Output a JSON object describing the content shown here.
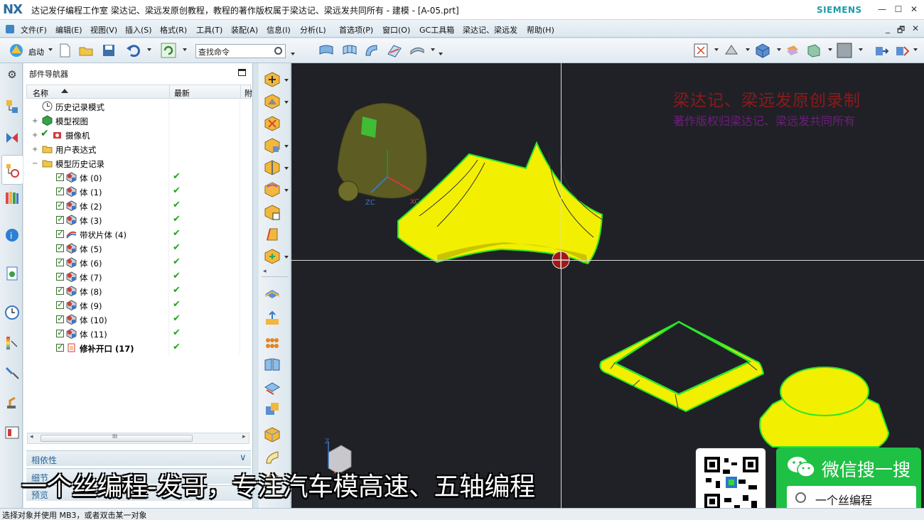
{
  "titlebar": {
    "logo": "NX",
    "title": "达记发仔编程工作室  梁达记、梁远发原创教程，教程的著作版权属于梁达记、梁远发共同所有 - 建模 - [A-05.prt]",
    "brand": "SIEMENS",
    "minimize": "—",
    "maximize": "☐",
    "close": "✕"
  },
  "menubar": {
    "items": [
      "文件(F)",
      "编辑(E)",
      "视图(V)",
      "插入(S)",
      "格式(R)",
      "工具(T)",
      "装配(A)",
      "信息(I)",
      "分析(L)",
      "首选项(P)",
      "窗口(O)",
      "GC工具箱",
      "梁达记、梁远发",
      "帮助(H)"
    ],
    "right": [
      "_",
      "🗗",
      "✕"
    ]
  },
  "toolbar": {
    "start_label": "启动",
    "search_placeholder": "查找命令"
  },
  "navigator": {
    "title": "部件导航器",
    "columns": [
      "名称",
      "最新",
      "附"
    ],
    "rows": [
      {
        "label": "历史记录模式",
        "level": 0,
        "icon": "clock-icon",
        "latest": false,
        "expand": ""
      },
      {
        "label": "模型视图",
        "level": 0,
        "icon": "model-view-icon",
        "latest": false,
        "expand": "+"
      },
      {
        "label": "摄像机",
        "level": 0,
        "icon": "camera-icon",
        "latest": false,
        "expand": "+"
      },
      {
        "label": "用户表达式",
        "level": 0,
        "icon": "folder-icon",
        "latest": false,
        "expand": "+"
      },
      {
        "label": "模型历史记录",
        "level": 0,
        "icon": "folder-icon",
        "latest": false,
        "expand": "−"
      },
      {
        "label": "体 (0)",
        "level": 1,
        "icon": "body-icon",
        "latest": true
      },
      {
        "label": "体 (1)",
        "level": 1,
        "icon": "body-icon",
        "latest": true
      },
      {
        "label": "体 (2)",
        "level": 1,
        "icon": "body-icon",
        "latest": true
      },
      {
        "label": "体 (3)",
        "level": 1,
        "icon": "body-icon",
        "latest": true
      },
      {
        "label": "带状片体 (4)",
        "level": 1,
        "icon": "ribbon-sheet-icon",
        "latest": true
      },
      {
        "label": "体 (5)",
        "level": 1,
        "icon": "body-icon",
        "latest": true
      },
      {
        "label": "体 (6)",
        "level": 1,
        "icon": "body-icon",
        "latest": true
      },
      {
        "label": "体 (7)",
        "level": 1,
        "icon": "body-icon",
        "latest": true
      },
      {
        "label": "体 (8)",
        "level": 1,
        "icon": "body-icon",
        "latest": true
      },
      {
        "label": "体 (9)",
        "level": 1,
        "icon": "body-icon",
        "latest": true
      },
      {
        "label": "体 (10)",
        "level": 1,
        "icon": "body-icon",
        "latest": true
      },
      {
        "label": "体 (11)",
        "level": 1,
        "icon": "body-icon",
        "latest": true
      },
      {
        "label": "修补开口 (17)",
        "level": 1,
        "icon": "patch-opening-icon",
        "latest": true,
        "bold": true
      }
    ],
    "scroll_grip": "III",
    "sections": [
      "相依性",
      "细节",
      "预览"
    ]
  },
  "viewport": {
    "watermark_line1": "梁达记、梁远发原创录制",
    "watermark_line2": "著作版权归梁达记、梁远发共同所有",
    "axis_labels": [
      "ZC",
      "XC",
      "Z"
    ],
    "subtitle": "一个丝编程-发哥，专注汽车模高速、五轴编程"
  },
  "promo": {
    "wechat_text": "微信搜一搜",
    "search_text": "一个丝编程"
  },
  "status": {
    "text": "选择对象并使用 MB3，或者双击某一对象"
  },
  "colors": {
    "accent": "#2a6496",
    "viewport_bg": "#202126",
    "surface_yellow": "#f2f000",
    "edge_green": "#29e629",
    "wechat_green": "#1ec143"
  }
}
